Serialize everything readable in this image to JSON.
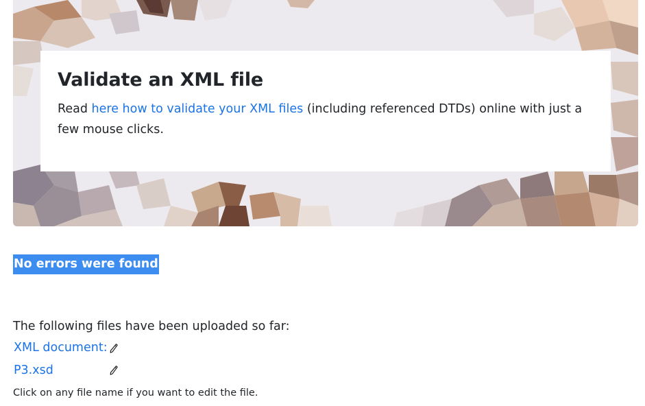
{
  "hero": {
    "title": "Validate an XML file",
    "text_before": "Read ",
    "link_text": "here how to validate your XML files",
    "text_after": " (including referenced DTDs) online with just a few mouse clicks."
  },
  "result": {
    "status": "No errors were found"
  },
  "files": {
    "intro": "The following files have been uploaded so far:",
    "items": [
      {
        "label": "XML document:",
        "icon": "pencil-edit-icon"
      },
      {
        "label": "P3.xsd",
        "icon": "pencil-edit-icon"
      }
    ],
    "hint": "Click on any file name if you want to edit the file."
  },
  "colors": {
    "link": "#1a73e8",
    "status_bg": "#3d8cf0",
    "text": "#212529"
  }
}
